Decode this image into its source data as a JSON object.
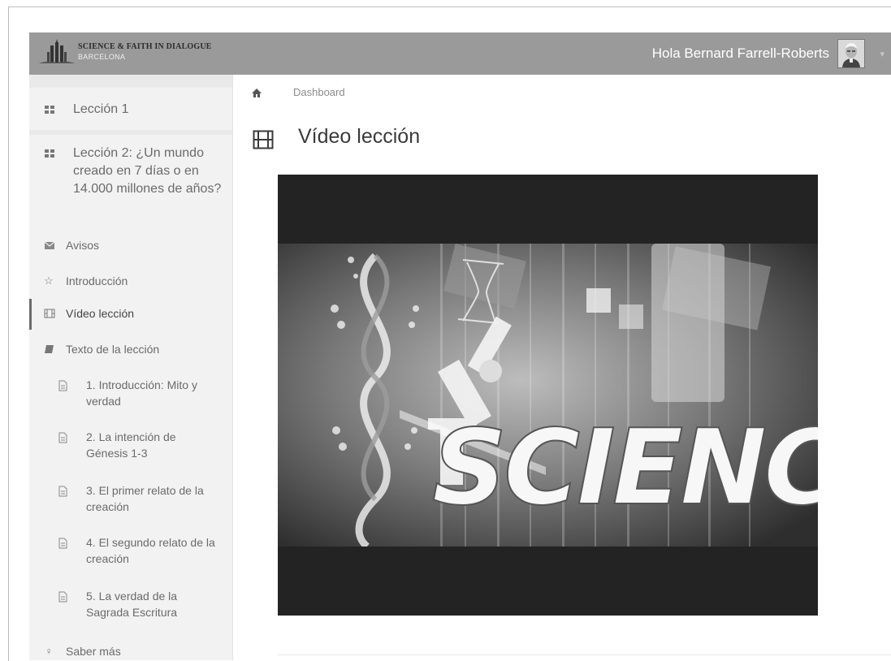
{
  "header": {
    "logo_title": "SCIENCE & FAITH IN DIALOGUE",
    "logo_subtitle": "BARCELONA",
    "greeting": "Hola Bernard Farrell-Roberts"
  },
  "sidebar": {
    "items": [
      {
        "label": "Lección 1",
        "icon": "grid-icon"
      },
      {
        "label": "Lección 2: ¿Un mundo creado en 7 días o en 14.000 millones de años?",
        "icon": "grid-icon"
      },
      {
        "label": "Avisos",
        "icon": "envelope-icon"
      },
      {
        "label": "Introducción",
        "icon": "star-icon"
      },
      {
        "label": "Vídeo lección",
        "icon": "film-icon",
        "active": true
      },
      {
        "label": "Texto de la lección",
        "icon": "book-icon"
      },
      {
        "label": "1. Introducción: Mito y verdad",
        "icon": "document-icon"
      },
      {
        "label": "2. La intención de Génesis 1-3",
        "icon": "document-icon"
      },
      {
        "label": "3. El primer relato de la creación",
        "icon": "document-icon"
      },
      {
        "label": "4. El segundo relato de la creación",
        "icon": "document-icon"
      },
      {
        "label": "5. La verdad de la Sagrada Escritura",
        "icon": "document-icon"
      },
      {
        "label": "Saber más",
        "icon": "lightbulb-icon"
      }
    ]
  },
  "main": {
    "breadcrumb": "Dashboard",
    "title": "Vídeo lección",
    "video_text": "SCIENC"
  },
  "colors": {
    "topbar": "#9a9a9a",
    "sidebar": "#f2f2f2",
    "video_bg": "#232323"
  }
}
